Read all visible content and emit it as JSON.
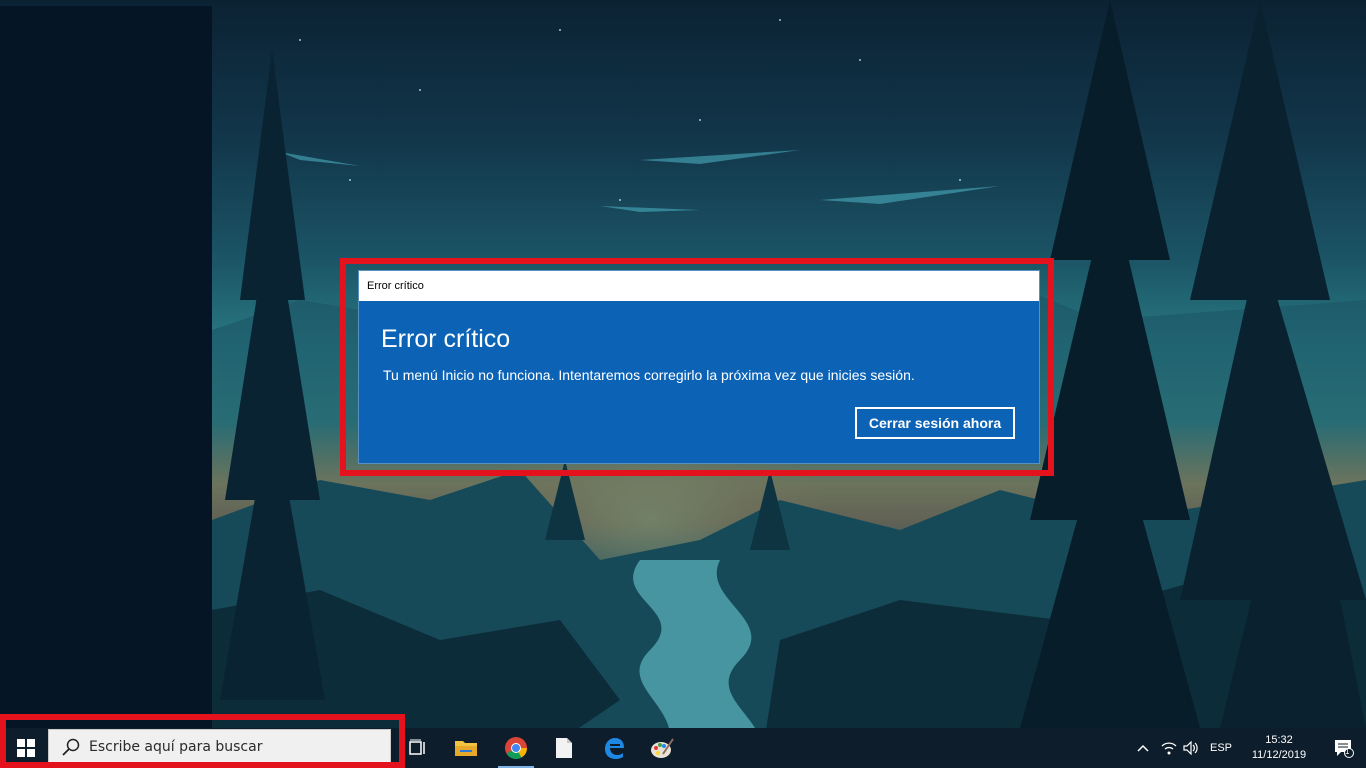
{
  "dialog": {
    "window_title": "Error crítico",
    "heading": "Error crítico",
    "message": "Tu menú Inicio no funciona. Intentaremos corregirlo la próxima vez que inicies sesión.",
    "button_label": "Cerrar sesión ahora"
  },
  "taskbar": {
    "search_placeholder": "Escribe aquí para buscar",
    "pinned_apps": [
      "task-view",
      "file-explorer",
      "chrome",
      "file",
      "edge",
      "paint"
    ],
    "tray": {
      "language": "ESP",
      "time": "15:32",
      "date": "11/12/2019",
      "notification_count": "1"
    }
  },
  "colors": {
    "highlight": "#e4121d",
    "dialog_bg": "#0c63b6",
    "taskbar_bg": "#0e1d2b"
  }
}
